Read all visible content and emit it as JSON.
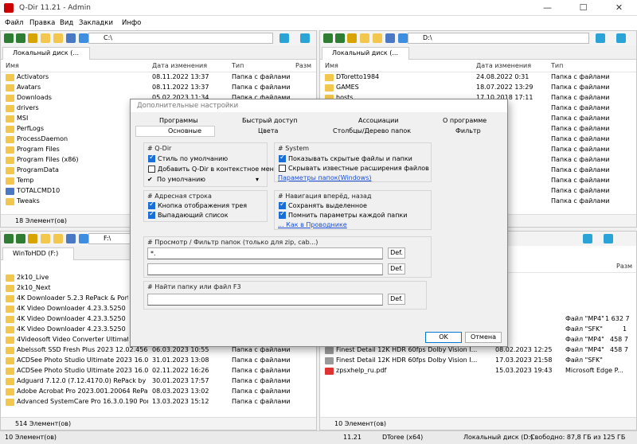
{
  "window": {
    "title": "Q-Dir 11.21 - Admin",
    "minimize": "—",
    "maximize": "☐",
    "close": "✕"
  },
  "menu": [
    "Файл",
    "Правка",
    "Вид",
    "Закладки",
    "Инфо"
  ],
  "columns": {
    "name": "Имя",
    "date": "Дата изменения",
    "type": "Тип",
    "size": "Разм"
  },
  "columns_br": {
    "size": "Разм"
  },
  "pane_tl": {
    "address": "C:\\",
    "tab": "Локальный диск (...",
    "status": "18 Элемент(ов)",
    "rows": [
      {
        "name": "Activators",
        "date": "08.11.2022 13:37",
        "type": "Папка с файлами"
      },
      {
        "name": "Avatars",
        "date": "08.11.2022 13:37",
        "type": "Папка с файлами"
      },
      {
        "name": "Downloads",
        "date": "05.02.2023 11:34",
        "type": "Папка с файлами"
      },
      {
        "name": "drivers",
        "date": "",
        "type": ""
      },
      {
        "name": "MSI",
        "date": "",
        "type": ""
      },
      {
        "name": "PerfLogs",
        "date": "",
        "type": ""
      },
      {
        "name": "ProcessDaemon",
        "date": "",
        "type": ""
      },
      {
        "name": "Program Files",
        "date": "",
        "type": ""
      },
      {
        "name": "Program Files (x86)",
        "date": "",
        "type": ""
      },
      {
        "name": "ProgramData",
        "date": "",
        "type": ""
      },
      {
        "name": "Temp",
        "date": "",
        "type": ""
      },
      {
        "name": "TOTALCMD10",
        "date": "",
        "type": ""
      },
      {
        "name": "Tweaks",
        "date": "",
        "type": ""
      }
    ]
  },
  "pane_tr": {
    "address": "D:\\",
    "tab": "Локальный диск (...",
    "rows": [
      {
        "name": "DToretto1984",
        "date": "24.08.2022 0:31",
        "type": "Папка с файлами"
      },
      {
        "name": "GAMES",
        "date": "18.07.2022 13:29",
        "type": "Папка с файлами"
      },
      {
        "name": "hosts",
        "date": "17.10.2018 17:11",
        "type": "Папка с файлами"
      },
      {
        "name": "",
        "date": "",
        "type": "Папка с файлами"
      },
      {
        "name": "",
        "date": "",
        "type": "Папка с файлами"
      },
      {
        "name": "",
        "date": "",
        "type": "Папка с файлами"
      },
      {
        "name": "",
        "date": "",
        "type": "Папка с файлами"
      },
      {
        "name": "",
        "date": "",
        "type": "Папка с файлами"
      },
      {
        "name": "",
        "date": "",
        "type": "Папка с файлами"
      },
      {
        "name": "",
        "date": "",
        "type": "Папка с файлами"
      },
      {
        "name": "",
        "date": "",
        "type": "Папка с файлами"
      },
      {
        "name": "",
        "date": "",
        "type": "Папка с файлами"
      },
      {
        "name": "",
        "date": "",
        "type": "Папка с файлами"
      }
    ]
  },
  "pane_bl": {
    "address": "F:\\",
    "tab": "WinToHDD (F:)",
    "status": "514 Элемент(ов)",
    "rows": [
      {
        "name": "2k10_Live",
        "date": "",
        "type": ""
      },
      {
        "name": "2k10_Next",
        "date": "",
        "type": ""
      },
      {
        "name": "4K Downloader 5.2.3 RePack & Portable",
        "date": "",
        "type": ""
      },
      {
        "name": "4K Video Downloader 4.23.3.5250 RePack",
        "date": "",
        "type": ""
      },
      {
        "name": "4K Video Downloader 4.23.3.5250 RePack",
        "date": "",
        "type": ""
      },
      {
        "name": "4K Video Downloader 4.23.3.5250 RePack",
        "date": "",
        "type": ""
      },
      {
        "name": "4Videosoft Video Converter Ultimate 7.2",
        "date": "",
        "type": ""
      },
      {
        "name": "Abelssoft SSD Fresh Plus 2023 12.02.45685 P...",
        "date": "06.03.2023 10:55",
        "type": "Папка с файлами"
      },
      {
        "name": "ACDSee Photo Studio Ultimate 2023 16.0.3....",
        "date": "31.01.2023 13:08",
        "type": "Папка с файлами"
      },
      {
        "name": "ACDSee Photo Studio Ultimate 2023 16.0.3....",
        "date": "02.11.2022 16:26",
        "type": "Папка с файлами"
      },
      {
        "name": "Adguard 7.12.0 (7.12.4170.0) RePack by KpoJ...",
        "date": "30.01.2023 17:57",
        "type": "Папка с файлами"
      },
      {
        "name": "Adobe Acrobat Pro 2023.001.20064 RePack b...",
        "date": "08.03.2023 13:02",
        "type": "Папка с файлами"
      },
      {
        "name": "Advanced SystemCare Pro 16.3.0.190 Portab...",
        "date": "13.03.2023 15:12",
        "type": "Папка с файлами"
      }
    ]
  },
  "pane_br": {
    "status": "10 Элемент(ов)",
    "rows": [
      {
        "name": "",
        "date": "",
        "type": "Файл \"MP4\"",
        "size": "1 632 7"
      },
      {
        "name": "",
        "date": "",
        "type": "Файл \"SFK\"",
        "size": "1"
      },
      {
        "name": "",
        "date": "",
        "type": "Файл \"MP4\"",
        "size": "458 7"
      },
      {
        "name": "Finest Detail 12K HDR 60fps  Dolby Vision I...",
        "date": "08.02.2023 12:25",
        "type": "Файл \"MP4\"",
        "size": "458 7"
      },
      {
        "name": "Finest Detail 12K HDR 60fps  Dolby Vision I...",
        "date": "17.03.2023 21:58",
        "type": "Файл \"SFK\"",
        "size": ""
      },
      {
        "name": "zpsxhelp_ru.pdf",
        "date": "15.03.2023 19:43",
        "type": "Microsoft Edge P...",
        "size": ""
      }
    ]
  },
  "dialog": {
    "title": "Дополнительные настройки",
    "tabs_row1": [
      "Программы",
      "Быстрый доступ",
      "Ассоциации",
      "О программе"
    ],
    "tabs_row2": [
      "Основные",
      "Цвета",
      "Столбцы/Дерево папок",
      "Фильтр"
    ],
    "qdir": {
      "title": "# Q-Dir",
      "items": [
        {
          "label": "Стиль по умолчанию",
          "checked": true
        },
        {
          "label": "Добавить Q-Dir в контекстное меню",
          "checked": false
        }
      ],
      "default_label": "По умолчанию"
    },
    "system": {
      "title": "# System",
      "items": [
        {
          "label": "Показывать скрытые файлы и папки",
          "checked": true
        },
        {
          "label": "Скрывать известные расширения файлов",
          "checked": false
        }
      ],
      "link": "Параметры папок(Windows)"
    },
    "address": {
      "title": "# Адресная строка",
      "items": [
        {
          "label": "Кнопка отображения трея",
          "checked": true
        },
        {
          "label": "Выпадающий список",
          "checked": true
        }
      ]
    },
    "nav": {
      "title": "# Навигация вперёд, назад",
      "items": [
        {
          "label": "Сохранять выделенное",
          "checked": true
        },
        {
          "label": "Помнить параметры каждой папки",
          "checked": true
        }
      ],
      "link": "... Как в Проводнике"
    },
    "filter": {
      "title": "# Просмотр / Фильтр папок (только для zip, cab...)",
      "value1": "*.",
      "value2": "",
      "def": "Def."
    },
    "find": {
      "title": "# Найти папку или файл   F3",
      "value": "",
      "def": "Def."
    },
    "ok": "OK",
    "cancel": "Отмена"
  },
  "bottom": {
    "count": "10 Элемент(ов)",
    "version": "11.21",
    "user": "DToree (x64)",
    "disk": "Локальный диск (D:)",
    "free": "Свободно: 87,8 ГБ из 125 ГБ"
  }
}
